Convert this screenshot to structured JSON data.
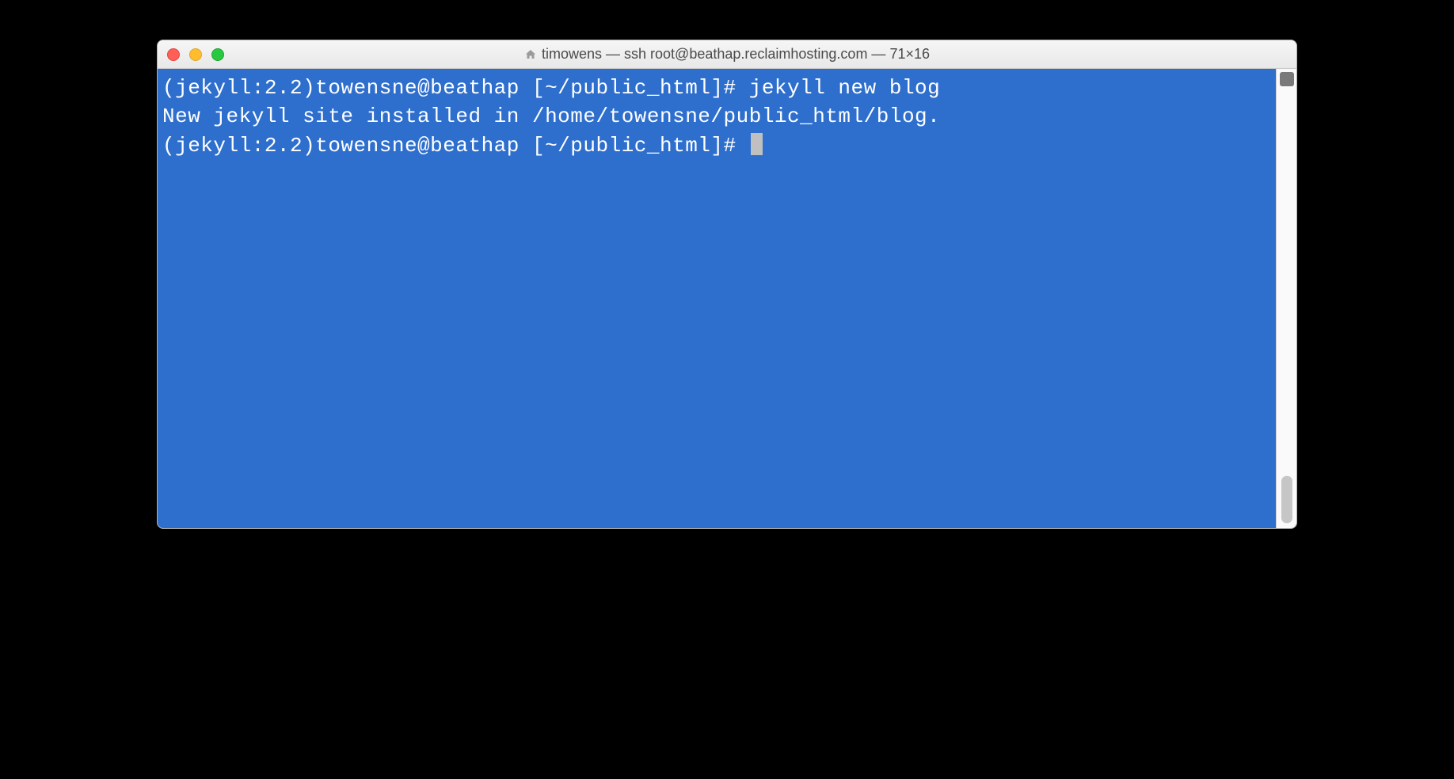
{
  "window": {
    "title": "timowens — ssh root@beathap.reclaimhosting.com — 71×16"
  },
  "terminal": {
    "lines": [
      {
        "prompt": "(jekyll:2.2)towensne@beathap [~/public_html]# ",
        "command": "jekyll new blog"
      },
      {
        "output": "New jekyll site installed in /home/towensne/public_html/blog."
      },
      {
        "prompt": "(jekyll:2.2)towensne@beathap [~/public_html]# ",
        "command": "",
        "cursor": true
      }
    ]
  }
}
